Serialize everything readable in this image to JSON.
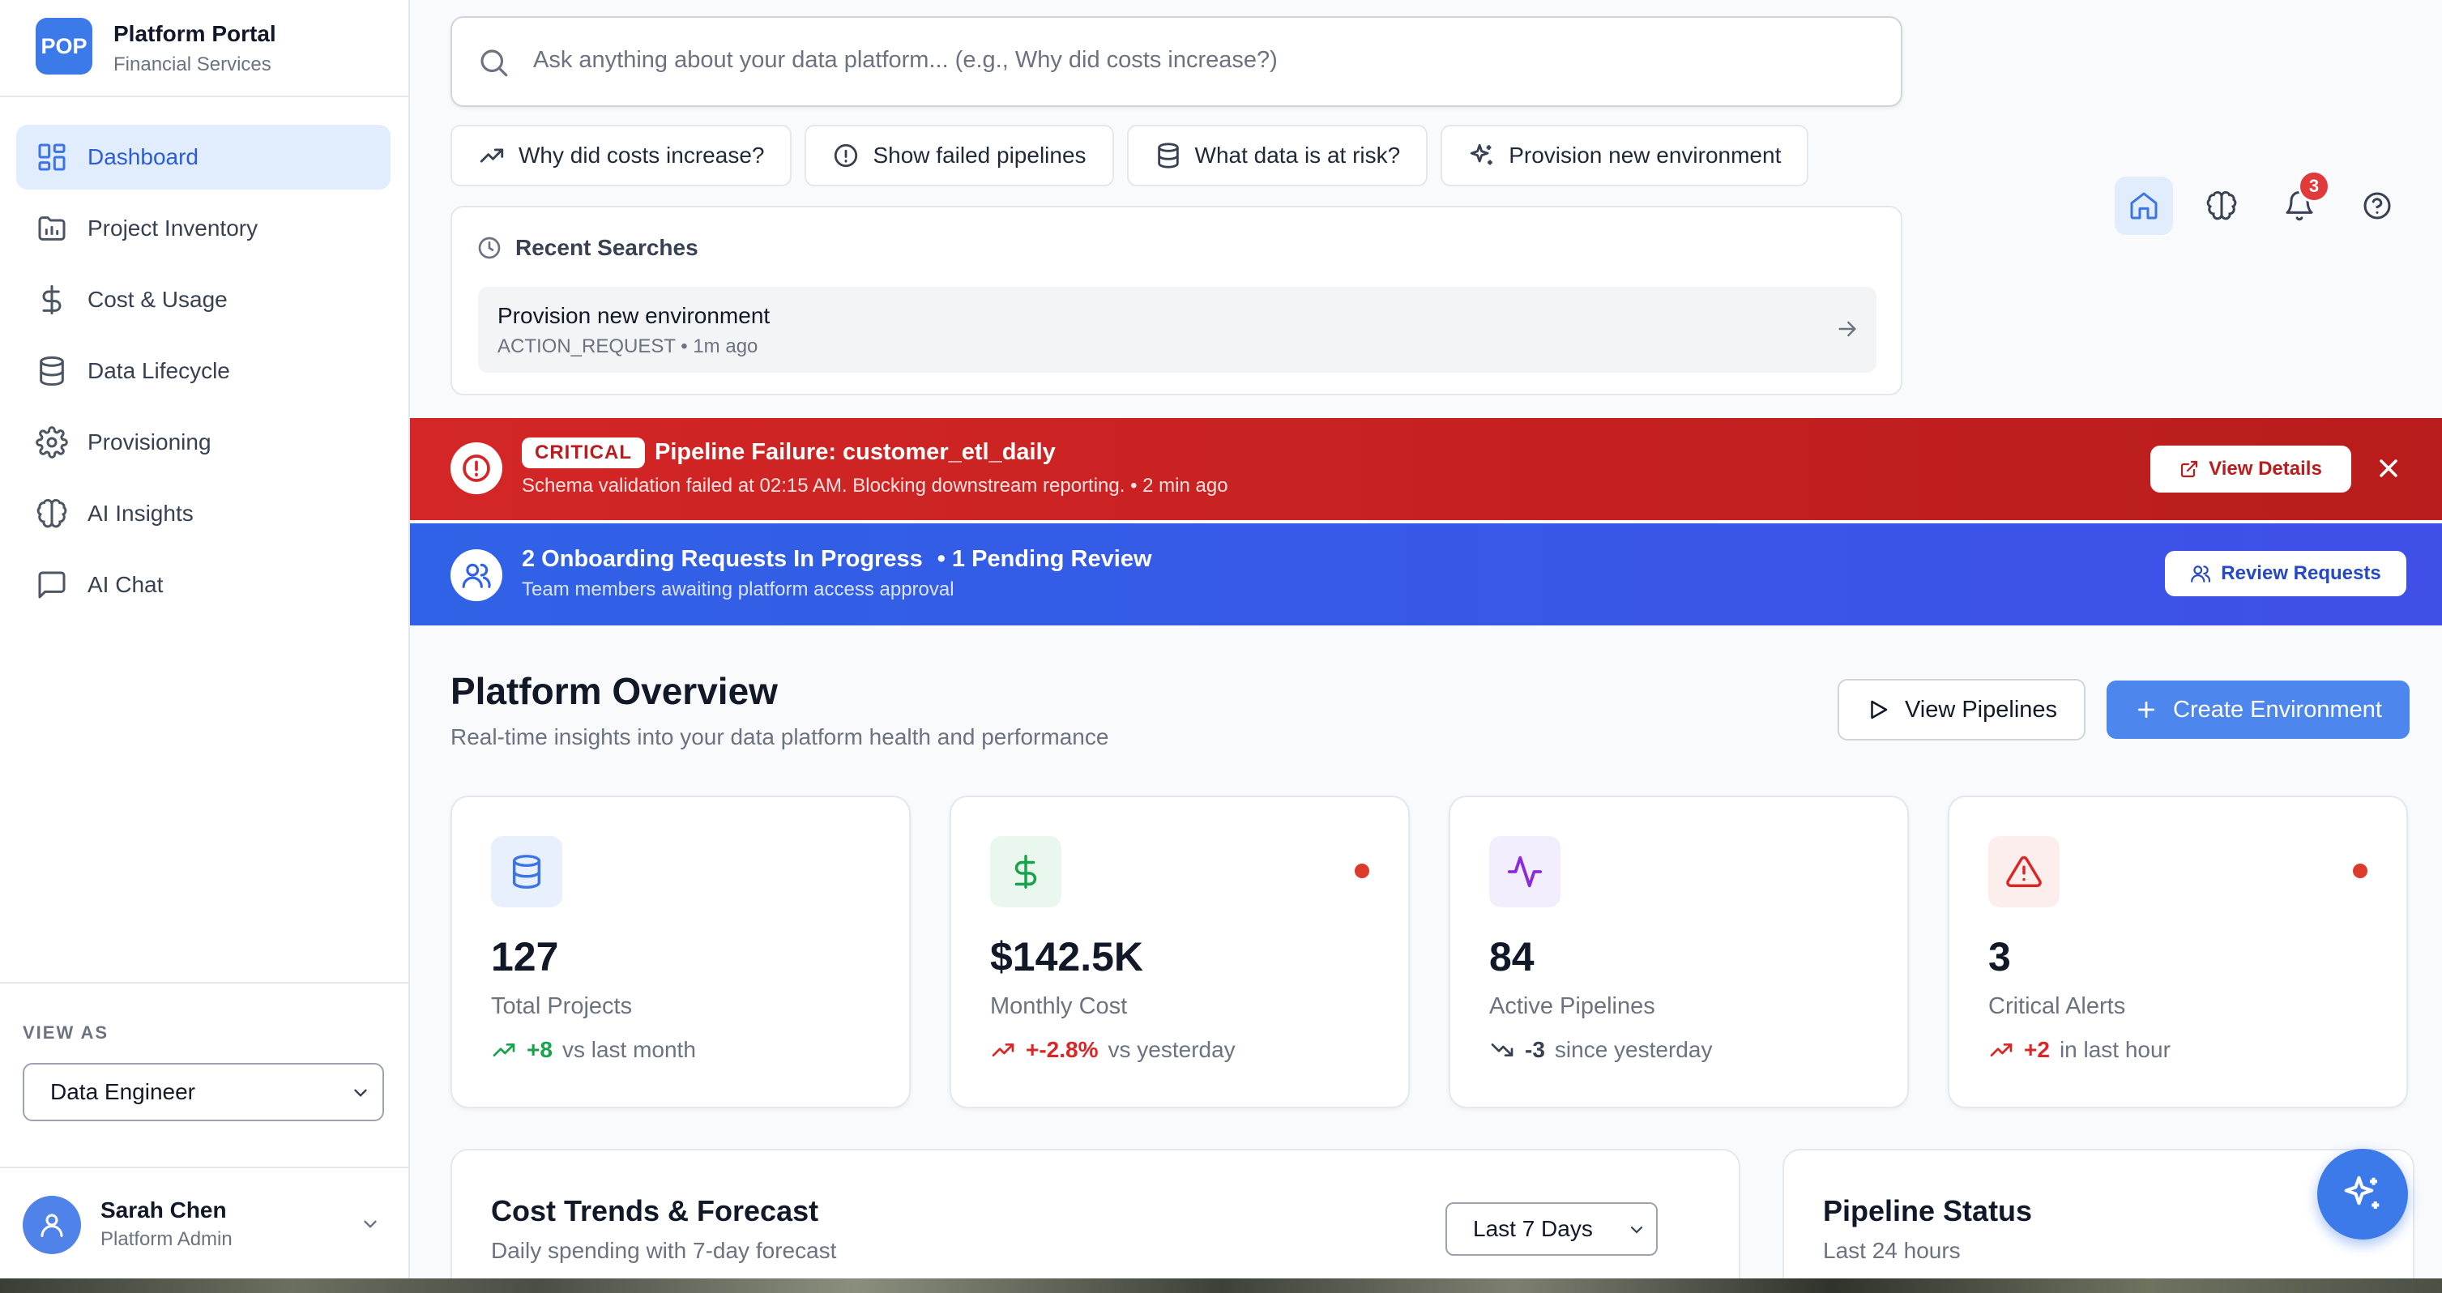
{
  "brand": {
    "logo_text": "POP",
    "name": "Platform Portal",
    "subtitle": "Financial Services"
  },
  "sidebar": {
    "items": [
      {
        "label": "Dashboard",
        "icon": "dashboard-grid-icon",
        "active": true
      },
      {
        "label": "Project Inventory",
        "icon": "folder-chart-icon"
      },
      {
        "label": "Cost & Usage",
        "icon": "dollar-icon"
      },
      {
        "label": "Data Lifecycle",
        "icon": "database-icon"
      },
      {
        "label": "Provisioning",
        "icon": "gear-icon"
      },
      {
        "label": "AI Insights",
        "icon": "brain-icon"
      },
      {
        "label": "AI Chat",
        "icon": "chat-icon"
      }
    ],
    "view_as_label": "VIEW AS",
    "view_as_value": "Data Engineer",
    "user": {
      "name": "Sarah Chen",
      "role": "Platform Admin"
    }
  },
  "search": {
    "placeholder": "Ask anything about your data platform... (e.g., Why did costs increase?)"
  },
  "chips": [
    {
      "label": "Why did costs increase?",
      "icon": "trend-up-icon"
    },
    {
      "label": "Show failed pipelines",
      "icon": "alert-circle-icon"
    },
    {
      "label": "What data is at risk?",
      "icon": "database-icon"
    },
    {
      "label": "Provision new environment",
      "icon": "sparkles-icon"
    }
  ],
  "recent": {
    "title": "Recent Searches",
    "items": [
      {
        "title": "Provision new environment",
        "meta": "ACTION_REQUEST • 1m ago"
      }
    ]
  },
  "header_icons": {
    "notification_count": "3"
  },
  "alert": {
    "badge": "CRITICAL",
    "title": "Pipeline Failure: customer_etl_daily",
    "subtitle": "Schema validation failed at 02:15 AM. Blocking downstream reporting. • 2 min ago",
    "button": "View Details",
    "color": "#c81e1e"
  },
  "onboarding": {
    "title": "2 Onboarding Requests In Progress",
    "pending": "• 1 Pending Review",
    "subtitle": "Team members awaiting platform access approval",
    "button": "Review Requests",
    "color": "#3358e6"
  },
  "overview": {
    "title": "Platform Overview",
    "subtitle": "Real-time insights into your data platform health and performance",
    "view_pipelines": "View Pipelines",
    "create_env": "Create Environment"
  },
  "metrics": [
    {
      "value": "127",
      "label": "Total Projects",
      "delta": "+8",
      "delta_text": "vs last month",
      "trend": "up",
      "delta_color": "#16a34a",
      "icon": "database-icon",
      "alert_dot": false
    },
    {
      "value": "$142.5K",
      "label": "Monthly Cost",
      "delta": "+-2.8%",
      "delta_text": "vs yesterday",
      "trend": "up",
      "delta_color": "#dc2626",
      "icon": "dollar-icon",
      "alert_dot": true
    },
    {
      "value": "84",
      "label": "Active Pipelines",
      "delta": "-3",
      "delta_text": "since yesterday",
      "trend": "down",
      "delta_color": "#374151",
      "icon": "activity-icon",
      "alert_dot": false
    },
    {
      "value": "3",
      "label": "Critical Alerts",
      "delta": "+2",
      "delta_text": "in last hour",
      "trend": "up",
      "delta_color": "#dc2626",
      "icon": "warning-triangle-icon",
      "alert_dot": true
    }
  ],
  "cost_panel": {
    "title": "Cost Trends & Forecast",
    "subtitle": "Daily spending with 7-day forecast",
    "range": "Last 7 Days"
  },
  "pipeline_panel": {
    "title": "Pipeline Status",
    "subtitle": "Last 24 hours"
  }
}
